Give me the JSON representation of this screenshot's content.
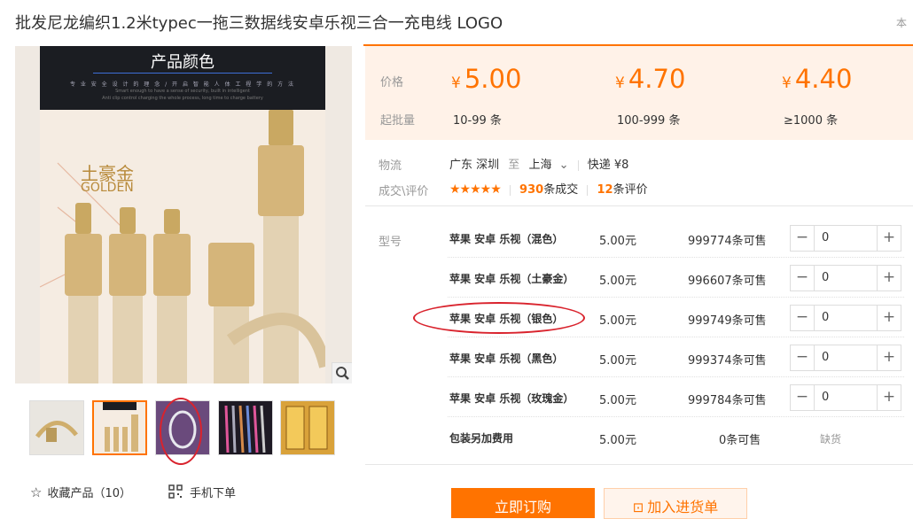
{
  "product": {
    "title": "批发尼龙编织1.2米typec一拖三数据线安卓乐视三合一充电线 LOGO",
    "topright_text": "本"
  },
  "gallery": {
    "hero_title": "产品颜色",
    "hero_sub": "专 业 安 全 设 计 的 理 念 / 开 启 智 能 人 体 工 程 学 的 方 法",
    "hero_sub2": "Smart enough to have a sense of security, built in intelligent",
    "hero_sub3": "Anti clip control charging the whole process, long time to charge battery",
    "color_cn": "土豪金",
    "color_en": "GOLDEN",
    "zoom_icon": "magnifier-icon",
    "thumbnails": [
      {
        "id": "thumb-1",
        "selected": false
      },
      {
        "id": "thumb-2",
        "selected": true
      },
      {
        "id": "thumb-3",
        "selected": false
      },
      {
        "id": "thumb-4",
        "selected": false
      },
      {
        "id": "thumb-5",
        "selected": false
      }
    ],
    "favorite_label": "收藏产品（10）",
    "mobile_label": "手机下单"
  },
  "pricing": {
    "price_label": "价格",
    "batch_label": "起批量",
    "currency": "¥",
    "tiers": [
      {
        "price": "5.00",
        "range": "10-99 条"
      },
      {
        "price": "4.70",
        "range": "100-999 条"
      },
      {
        "price": "4.40",
        "range": "≥1000 条"
      }
    ]
  },
  "logistics": {
    "label": "物流",
    "from": "广东 深圳",
    "to_word": "至",
    "to": "上海",
    "express": "快递 ¥8"
  },
  "reviews": {
    "label": "成交\\评价",
    "stars": "★★★★★",
    "deals_count": "930",
    "deals_suffix": "条成交",
    "review_count": "12",
    "review_suffix": "条评价"
  },
  "sku": {
    "label": "型号",
    "rows": [
      {
        "name": "苹果 安卓 乐视（混色）",
        "price": "5.00元",
        "stock": "999774条可售",
        "qty": "0"
      },
      {
        "name": "苹果 安卓 乐视（土豪金）",
        "price": "5.00元",
        "stock": "996607条可售",
        "qty": "0"
      },
      {
        "name": "苹果 安卓 乐视（银色）",
        "price": "5.00元",
        "stock": "999749条可售",
        "qty": "0"
      },
      {
        "name": "苹果 安卓 乐视（黑色）",
        "price": "5.00元",
        "stock": "999374条可售",
        "qty": "0"
      },
      {
        "name": "苹果 安卓 乐视（玫瑰金）",
        "price": "5.00元",
        "stock": "999784条可售",
        "qty": "0"
      },
      {
        "name": "包装另加费用",
        "price": "5.00元",
        "stock": "0条可售",
        "status": "缺货"
      }
    ]
  },
  "actions": {
    "buy_label": "立即订购",
    "cart_label": "加入进货单"
  },
  "colors": {
    "accent": "#ff7300",
    "annotation_red": "#d9232d",
    "price_bg": "#fff2e8"
  }
}
